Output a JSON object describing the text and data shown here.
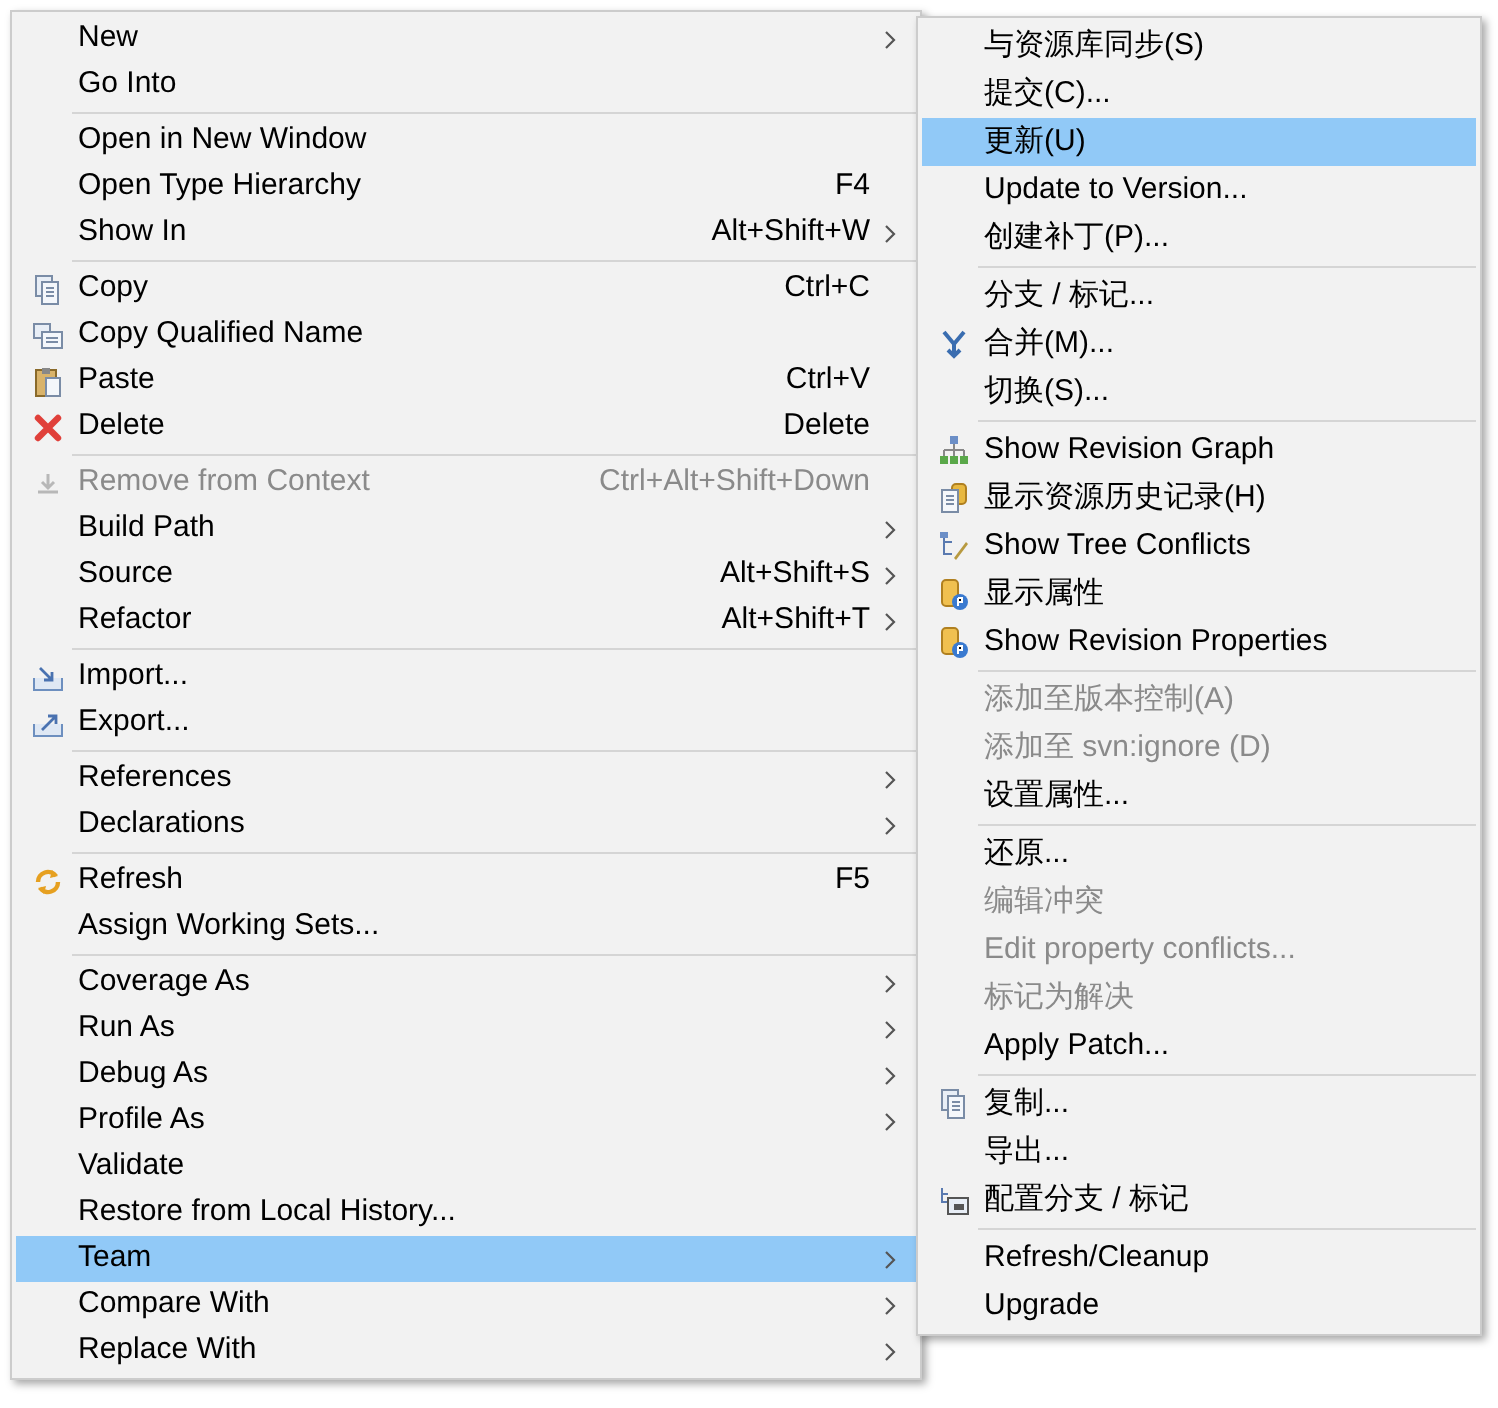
{
  "main_menu": {
    "items": [
      {
        "kind": "item",
        "label": "New",
        "submenu": true,
        "disabled": false,
        "selected": false
      },
      {
        "kind": "item",
        "label": "Go Into",
        "submenu": false,
        "disabled": false,
        "selected": false
      },
      {
        "kind": "separator"
      },
      {
        "kind": "item",
        "label": "Open in New Window",
        "submenu": false,
        "disabled": false,
        "selected": false
      },
      {
        "kind": "item",
        "label": "Open Type Hierarchy",
        "shortcut": "F4",
        "submenu": false,
        "disabled": false,
        "selected": false
      },
      {
        "kind": "item",
        "label": "Show In",
        "shortcut": "Alt+Shift+W",
        "submenu": true,
        "disabled": false,
        "selected": false
      },
      {
        "kind": "separator"
      },
      {
        "kind": "item",
        "label": "Copy",
        "shortcut": "Ctrl+C",
        "submenu": false,
        "disabled": false,
        "selected": false
      },
      {
        "kind": "item",
        "label": "Copy Qualified Name",
        "submenu": false,
        "disabled": false,
        "selected": false
      },
      {
        "kind": "item",
        "label": "Paste",
        "shortcut": "Ctrl+V",
        "submenu": false,
        "disabled": false,
        "selected": false
      },
      {
        "kind": "item",
        "label": "Delete",
        "shortcut": "Delete",
        "submenu": false,
        "disabled": false,
        "selected": false
      },
      {
        "kind": "separator"
      },
      {
        "kind": "item",
        "label": "Remove from Context",
        "shortcut": "Ctrl+Alt+Shift+Down",
        "submenu": false,
        "disabled": true,
        "selected": false
      },
      {
        "kind": "item",
        "label": "Build Path",
        "submenu": true,
        "disabled": false,
        "selected": false
      },
      {
        "kind": "item",
        "label": "Source",
        "shortcut": "Alt+Shift+S",
        "submenu": true,
        "disabled": false,
        "selected": false
      },
      {
        "kind": "item",
        "label": "Refactor",
        "shortcut": "Alt+Shift+T",
        "submenu": true,
        "disabled": false,
        "selected": false
      },
      {
        "kind": "separator"
      },
      {
        "kind": "item",
        "label": "Import...",
        "submenu": false,
        "disabled": false,
        "selected": false
      },
      {
        "kind": "item",
        "label": "Export...",
        "submenu": false,
        "disabled": false,
        "selected": false
      },
      {
        "kind": "separator"
      },
      {
        "kind": "item",
        "label": "References",
        "submenu": true,
        "disabled": false,
        "selected": false
      },
      {
        "kind": "item",
        "label": "Declarations",
        "submenu": true,
        "disabled": false,
        "selected": false
      },
      {
        "kind": "separator"
      },
      {
        "kind": "item",
        "label": "Refresh",
        "shortcut": "F5",
        "submenu": false,
        "disabled": false,
        "selected": false
      },
      {
        "kind": "item",
        "label": "Assign Working Sets...",
        "submenu": false,
        "disabled": false,
        "selected": false
      },
      {
        "kind": "separator"
      },
      {
        "kind": "item",
        "label": "Coverage As",
        "submenu": true,
        "disabled": false,
        "selected": false
      },
      {
        "kind": "item",
        "label": "Run As",
        "submenu": true,
        "disabled": false,
        "selected": false
      },
      {
        "kind": "item",
        "label": "Debug As",
        "submenu": true,
        "disabled": false,
        "selected": false
      },
      {
        "kind": "item",
        "label": "Profile As",
        "submenu": true,
        "disabled": false,
        "selected": false
      },
      {
        "kind": "item",
        "label": "Validate",
        "submenu": false,
        "disabled": false,
        "selected": false
      },
      {
        "kind": "item",
        "label": "Restore from Local History...",
        "submenu": false,
        "disabled": false,
        "selected": false
      },
      {
        "kind": "item",
        "label": "Team",
        "submenu": true,
        "disabled": false,
        "selected": true
      },
      {
        "kind": "item",
        "label": "Compare With",
        "submenu": true,
        "disabled": false,
        "selected": false
      },
      {
        "kind": "item",
        "label": "Replace With",
        "submenu": true,
        "disabled": false,
        "selected": false
      }
    ]
  },
  "team_submenu": {
    "items": [
      {
        "kind": "item",
        "label": "与资源库同步(S)",
        "disabled": false,
        "selected": false
      },
      {
        "kind": "item",
        "label": "提交(C)...",
        "disabled": false,
        "selected": false
      },
      {
        "kind": "item",
        "label": "更新(U)",
        "disabled": false,
        "selected": true
      },
      {
        "kind": "item",
        "label": "Update to Version...",
        "disabled": false,
        "selected": false
      },
      {
        "kind": "item",
        "label": "创建补丁(P)...",
        "disabled": false,
        "selected": false
      },
      {
        "kind": "separator"
      },
      {
        "kind": "item",
        "label": "分支 / 标记...",
        "disabled": false,
        "selected": false
      },
      {
        "kind": "item",
        "label": "合并(M)...",
        "disabled": false,
        "selected": false
      },
      {
        "kind": "item",
        "label": "切换(S)...",
        "disabled": false,
        "selected": false
      },
      {
        "kind": "separator"
      },
      {
        "kind": "item",
        "label": "Show Revision Graph",
        "disabled": false,
        "selected": false
      },
      {
        "kind": "item",
        "label": "显示资源历史记录(H)",
        "disabled": false,
        "selected": false
      },
      {
        "kind": "item",
        "label": "Show Tree Conflicts",
        "disabled": false,
        "selected": false
      },
      {
        "kind": "item",
        "label": "显示属性",
        "disabled": false,
        "selected": false
      },
      {
        "kind": "item",
        "label": "Show Revision Properties",
        "disabled": false,
        "selected": false
      },
      {
        "kind": "separator"
      },
      {
        "kind": "item",
        "label": "添加至版本控制(A)",
        "disabled": true,
        "selected": false
      },
      {
        "kind": "item",
        "label": "添加至 svn:ignore (D)",
        "disabled": true,
        "selected": false
      },
      {
        "kind": "item",
        "label": "设置属性...",
        "disabled": false,
        "selected": false
      },
      {
        "kind": "separator"
      },
      {
        "kind": "item",
        "label": "还原...",
        "disabled": false,
        "selected": false
      },
      {
        "kind": "item",
        "label": "编辑冲突",
        "disabled": true,
        "selected": false
      },
      {
        "kind": "item",
        "label": "Edit property conflicts...",
        "disabled": true,
        "selected": false
      },
      {
        "kind": "item",
        "label": "标记为解决",
        "disabled": true,
        "selected": false
      },
      {
        "kind": "item",
        "label": "Apply Patch...",
        "disabled": false,
        "selected": false
      },
      {
        "kind": "separator"
      },
      {
        "kind": "item",
        "label": "复制...",
        "disabled": false,
        "selected": false
      },
      {
        "kind": "item",
        "label": "导出...",
        "disabled": false,
        "selected": false
      },
      {
        "kind": "item",
        "label": "配置分支 / 标记",
        "disabled": false,
        "selected": false
      },
      {
        "kind": "separator"
      },
      {
        "kind": "item",
        "label": "Refresh/Cleanup",
        "disabled": false,
        "selected": false
      },
      {
        "kind": "item",
        "label": "Upgrade",
        "disabled": false,
        "selected": false
      }
    ]
  }
}
